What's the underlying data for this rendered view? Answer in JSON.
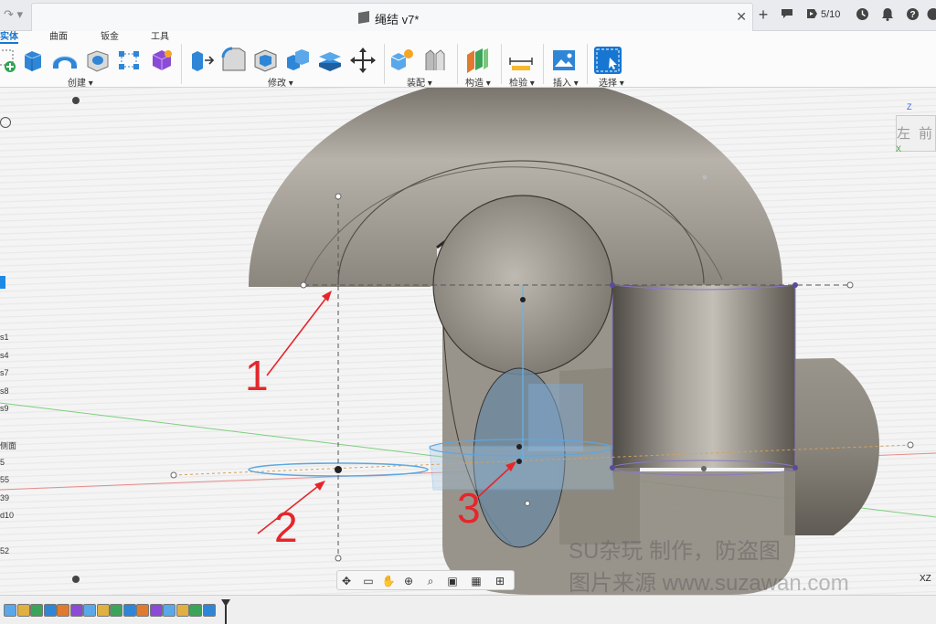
{
  "window": {
    "document_title": "绳结 v7*",
    "job_count": "5/10",
    "icons": [
      "redo-icon",
      "document-cube-icon",
      "close-icon",
      "new-tab-plus-icon",
      "comment-icon",
      "job-status-icon",
      "clock-icon",
      "notification-bell-icon",
      "help-icon",
      "account-icon"
    ]
  },
  "ribbon": {
    "tabs": [
      {
        "label": "实体",
        "active": true
      },
      {
        "label": "曲面",
        "active": false
      },
      {
        "label": "钣金",
        "active": false
      },
      {
        "label": "工具",
        "active": false
      }
    ],
    "groups": [
      {
        "label": "创建 ▾",
        "icons": [
          "create-sketch-icon",
          "extrude-icon",
          "revolve-icon",
          "hole-icon",
          "pattern-icon",
          "form-icon"
        ]
      },
      {
        "label": "修改 ▾",
        "icons": [
          "press-pull-icon",
          "fillet-icon",
          "shell-icon",
          "combine-icon",
          "offset-face-icon",
          "move-icon"
        ]
      },
      {
        "label": "装配 ▾",
        "icons": [
          "new-component-icon",
          "joint-icon"
        ]
      },
      {
        "label": "构造 ▾",
        "icons": [
          "construct-plane-icon"
        ]
      },
      {
        "label": "检验 ▾",
        "icons": [
          "measure-icon"
        ]
      },
      {
        "label": "插入 ▾",
        "icons": [
          "insert-image-icon"
        ]
      },
      {
        "label": "选择 ▾",
        "icons": [
          "select-icon"
        ]
      }
    ]
  },
  "browser": {
    "items": [
      "s1",
      "s4",
      "s7",
      "s8",
      "s9",
      "侧面",
      "5",
      "55",
      "39",
      "d10",
      "52"
    ]
  },
  "viewcube": {
    "z_label": "Z",
    "x_label": "X",
    "left_face": "左",
    "front_face": "前"
  },
  "nav_toolbar": {
    "icons": [
      "orbit-icon",
      "look-at-icon",
      "pan-hand-icon",
      "zoom-icon",
      "fit-icon",
      "display-settings-icon",
      "grid-icon",
      "viewports-icon"
    ]
  },
  "plane_label": "XZ",
  "annotations": [
    "1",
    "2",
    "3"
  ],
  "watermark": {
    "line1": "SU杂玩 制作，防盗图",
    "line2": "图片来源 www.suzawan.com"
  },
  "timeline": {
    "feature_count": 16
  }
}
